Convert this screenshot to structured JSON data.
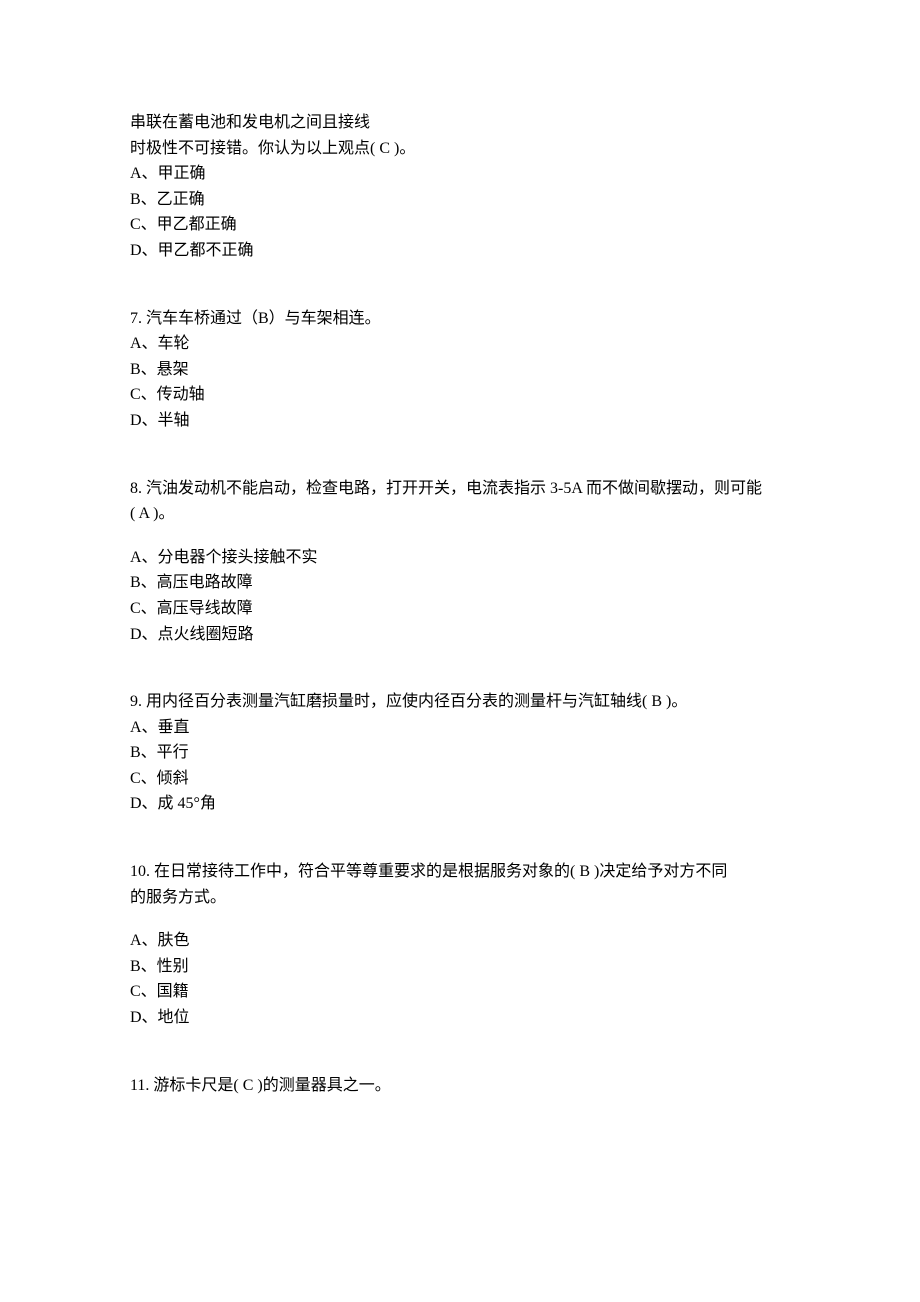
{
  "q6": {
    "stem1": "串联在蓄电池和发电机之间且接线",
    "stem2": "时极性不可接错。你认为以上观点( C )。",
    "a": "A、甲正确",
    "b": "B、乙正确",
    "c": "C、甲乙都正确",
    "d": "D、甲乙都不正确"
  },
  "q7": {
    "stem": "7. 汽车车桥通过（B）与车架相连。",
    "a": "A、车轮",
    "b": "B、悬架",
    "c": "C、传动轴",
    "d": "D、半轴"
  },
  "q8": {
    "stem1": "8. 汽油发动机不能启动，检查电路，打开开关，电流表指示 3-5A 而不做间歇摆动，则可能",
    "stem2": "(    A    )。",
    "a": "A、分电器个接头接触不实",
    "b": "B、高压电路故障",
    "c": "C、高压导线故障",
    "d": "D、点火线圈短路"
  },
  "q9": {
    "stem": "9. 用内径百分表测量汽缸磨损量时，应使内径百分表的测量杆与汽缸轴线( B )。",
    "a": "A、垂直",
    "b": "B、平行",
    "c": "C、倾斜",
    "d": "D、成 45°角"
  },
  "q10": {
    "stem1": "10. 在日常接待工作中，符合平等尊重要求的是根据服务对象的(    B    )决定给予对方不同",
    "stem2": "的服务方式。",
    "a": "A、肤色",
    "b": "B、性别",
    "c": "C、国籍",
    "d": "D、地位"
  },
  "q11": {
    "stem": "11. 游标卡尺是(    C    )的测量器具之一。"
  }
}
